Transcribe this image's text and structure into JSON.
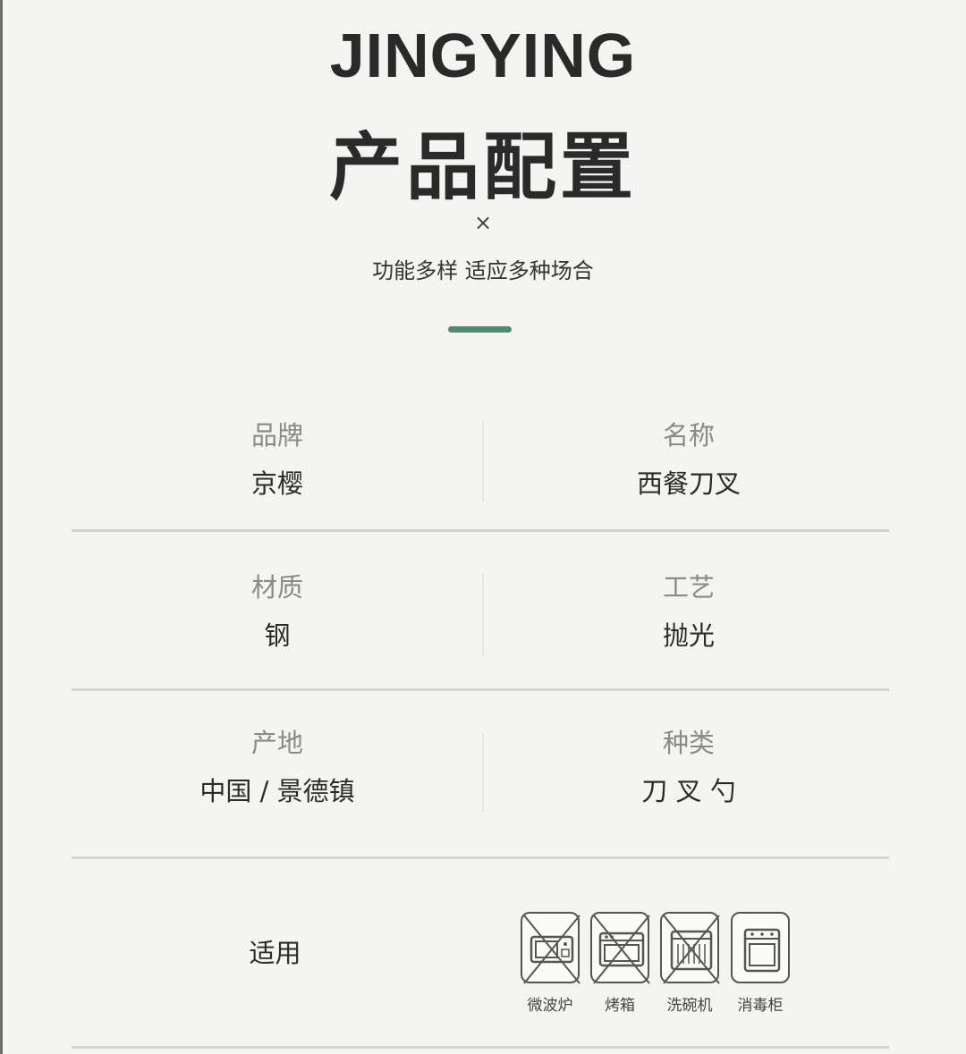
{
  "header": {
    "brand": "JINGYING",
    "title": "产品配置",
    "cross": "×",
    "subtitle": "功能多样 适应多种场合"
  },
  "specs": [
    {
      "label": "品牌",
      "value": "京樱"
    },
    {
      "label": "名称",
      "value": "西餐刀叉"
    },
    {
      "label": "材质",
      "value": "钢"
    },
    {
      "label": "工艺",
      "value": "抛光"
    },
    {
      "label": "产地",
      "value": "中国 / 景德镇"
    },
    {
      "label": "种类",
      "value": "刀 叉 勺"
    }
  ],
  "usage": {
    "label": "适用",
    "appliances": [
      {
        "name": "微波炉",
        "icon": "microwave-icon",
        "allowed": false
      },
      {
        "name": "烤箱",
        "icon": "oven-icon",
        "allowed": false
      },
      {
        "name": "洗碗机",
        "icon": "dishwasher-icon",
        "allowed": false
      },
      {
        "name": "消毒柜",
        "icon": "sterilizer-cabinet-icon",
        "allowed": true
      }
    ]
  },
  "colors": {
    "accent": "#4b8c72",
    "background": "#f4f4f2",
    "text": "#2b2b2b",
    "label": "#8a8a8a"
  }
}
